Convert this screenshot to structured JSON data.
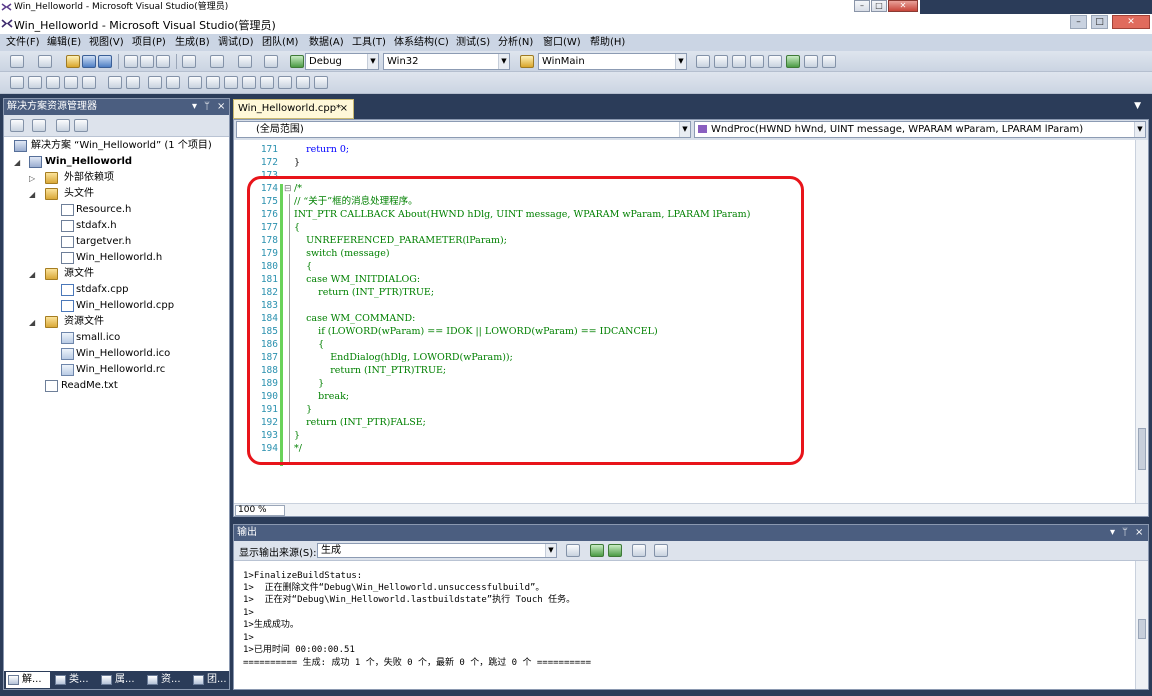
{
  "window": {
    "title": "Win_Helloworld - Microsoft Visual Studio(管理员)",
    "app_title": "Win_Helloworld - Microsoft Visual Studio(管理员)"
  },
  "menu": [
    "文件(F)",
    "编辑(E)",
    "视图(V)",
    "项目(P)",
    "生成(B)",
    "调试(D)",
    "团队(M)",
    "数据(A)",
    "工具(T)",
    "体系结构(C)",
    "测试(S)",
    "分析(N)",
    "窗口(W)",
    "帮助(H)"
  ],
  "toolbar": {
    "config": "Debug",
    "platform": "Win32",
    "find": "WinMain"
  },
  "solution_explorer": {
    "title": "解决方案资源管理器",
    "solution": "解决方案 “Win_Helloworld” (1 个项目)",
    "project": "Win_Helloworld",
    "items": [
      {
        "label": "外部依赖项"
      },
      {
        "label": "头文件"
      },
      {
        "label": "Resource.h"
      },
      {
        "label": "stdafx.h"
      },
      {
        "label": "targetver.h"
      },
      {
        "label": "Win_Helloworld.h"
      },
      {
        "label": "源文件"
      },
      {
        "label": "stdafx.cpp"
      },
      {
        "label": "Win_Helloworld.cpp"
      },
      {
        "label": "资源文件"
      },
      {
        "label": "small.ico"
      },
      {
        "label": "Win_Helloworld.ico"
      },
      {
        "label": "Win_Helloworld.rc"
      },
      {
        "label": "ReadMe.txt"
      }
    ],
    "bottom_tabs": [
      "解...",
      "类...",
      "属...",
      "资...",
      "团..."
    ]
  },
  "editor": {
    "tab": "Win_Helloworld.cpp*",
    "scope": "(全局范围)",
    "function": "WndProc(HWND hWnd, UINT message, WPARAM wParam, LPARAM lParam)",
    "zoom": "100 %",
    "lines": [
      {
        "n": "171",
        "text": "    return 0;"
      },
      {
        "n": "172",
        "text": "}"
      },
      {
        "n": "173",
        "text": ""
      },
      {
        "n": "174",
        "text": "/*"
      },
      {
        "n": "175",
        "text": "// “关于”框的消息处理程序。"
      },
      {
        "n": "176",
        "text": "INT_PTR CALLBACK About(HWND hDlg, UINT message, WPARAM wParam, LPARAM lParam)"
      },
      {
        "n": "177",
        "text": "{"
      },
      {
        "n": "178",
        "text": "    UNREFERENCED_PARAMETER(lParam);"
      },
      {
        "n": "179",
        "text": "    switch (message)"
      },
      {
        "n": "180",
        "text": "    {"
      },
      {
        "n": "181",
        "text": "    case WM_INITDIALOG:"
      },
      {
        "n": "182",
        "text": "        return (INT_PTR)TRUE;"
      },
      {
        "n": "183",
        "text": ""
      },
      {
        "n": "184",
        "text": "    case WM_COMMAND:"
      },
      {
        "n": "185",
        "text": "        if (LOWORD(wParam) == IDOK || LOWORD(wParam) == IDCANCEL)"
      },
      {
        "n": "186",
        "text": "        {"
      },
      {
        "n": "187",
        "text": "            EndDialog(hDlg, LOWORD(wParam));"
      },
      {
        "n": "188",
        "text": "            return (INT_PTR)TRUE;"
      },
      {
        "n": "189",
        "text": "        }"
      },
      {
        "n": "190",
        "text": "        break;"
      },
      {
        "n": "191",
        "text": "    }"
      },
      {
        "n": "192",
        "text": "    return (INT_PTR)FALSE;"
      },
      {
        "n": "193",
        "text": "}"
      },
      {
        "n": "194",
        "text": "*/"
      }
    ]
  },
  "output": {
    "title": "输出",
    "source_label": "显示输出来源(S):",
    "source_value": "生成",
    "lines": [
      "1>FinalizeBuildStatus:",
      "1>  正在删除文件“Debug\\Win_Helloworld.unsuccessfulbuild”。",
      "1>  正在对“Debug\\Win_Helloworld.lastbuildstate”执行 Touch 任务。",
      "1>",
      "1>生成成功。",
      "1>",
      "1>已用时间 00:00:00.51",
      "========== 生成: 成功 1 个，失败 0 个，最新 0 个，跳过 0 个 =========="
    ]
  }
}
